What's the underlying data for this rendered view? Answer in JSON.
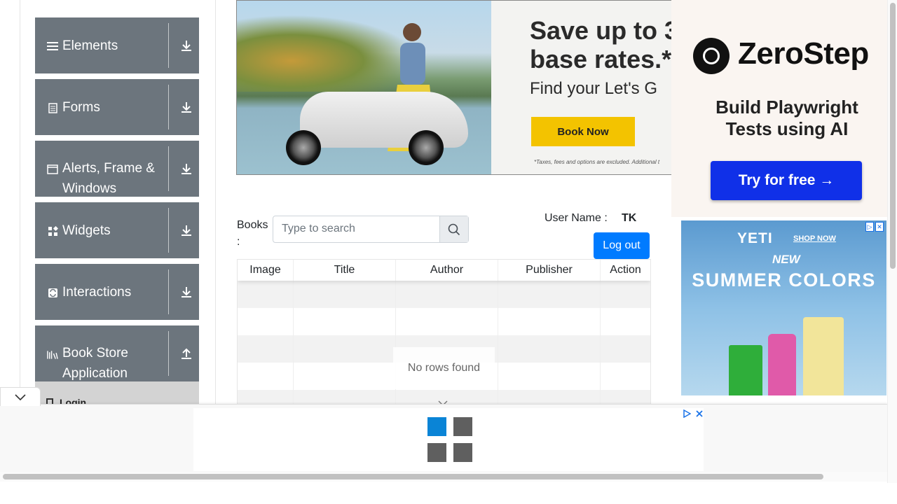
{
  "sidebar": {
    "groups": [
      {
        "label": "Elements",
        "icon": "hamburger-icon",
        "arrow": "download"
      },
      {
        "label": "Forms",
        "icon": "document-icon",
        "arrow": "download"
      },
      {
        "label": "Alerts, Frame & Windows",
        "icon": "window-icon",
        "arrow": "download"
      },
      {
        "label": "Widgets",
        "icon": "widgets-icon",
        "arrow": "download"
      },
      {
        "label": "Interactions",
        "icon": "interactions-icon",
        "arrow": "download"
      },
      {
        "label": "Book Store Application",
        "icon": "books-icon",
        "arrow": "upload"
      }
    ],
    "login_item": "Login"
  },
  "banner_ad": {
    "headline_1": "Save up to 3",
    "headline_2": "base rates.*",
    "sub": "Find your Let's G",
    "button": "Book Now",
    "fine_print": "*Taxes, fees and options are excluded. Additional t"
  },
  "zerostep_ad": {
    "brand": "ZeroStep",
    "tagline": "Build Playwright Tests using AI",
    "cta": "Try for free →"
  },
  "yeti_ad": {
    "brand": "YETI",
    "shop": "SHOP NOW",
    "new": "NEW",
    "headline": "SUMMER COLORS"
  },
  "books": {
    "label": "Books :",
    "search_placeholder": "Type to search",
    "username_label": "User Name :",
    "username_value": "TK",
    "logout_label": "Log out",
    "columns": [
      "Image",
      "Title",
      "Author",
      "Publisher",
      "Action"
    ],
    "empty_message": "No rows found"
  },
  "colors": {
    "sidebar_group": "#6c757d",
    "primary_button": "#007bff",
    "zerostep_button": "#1030e8",
    "banner_button": "#f3c300"
  }
}
